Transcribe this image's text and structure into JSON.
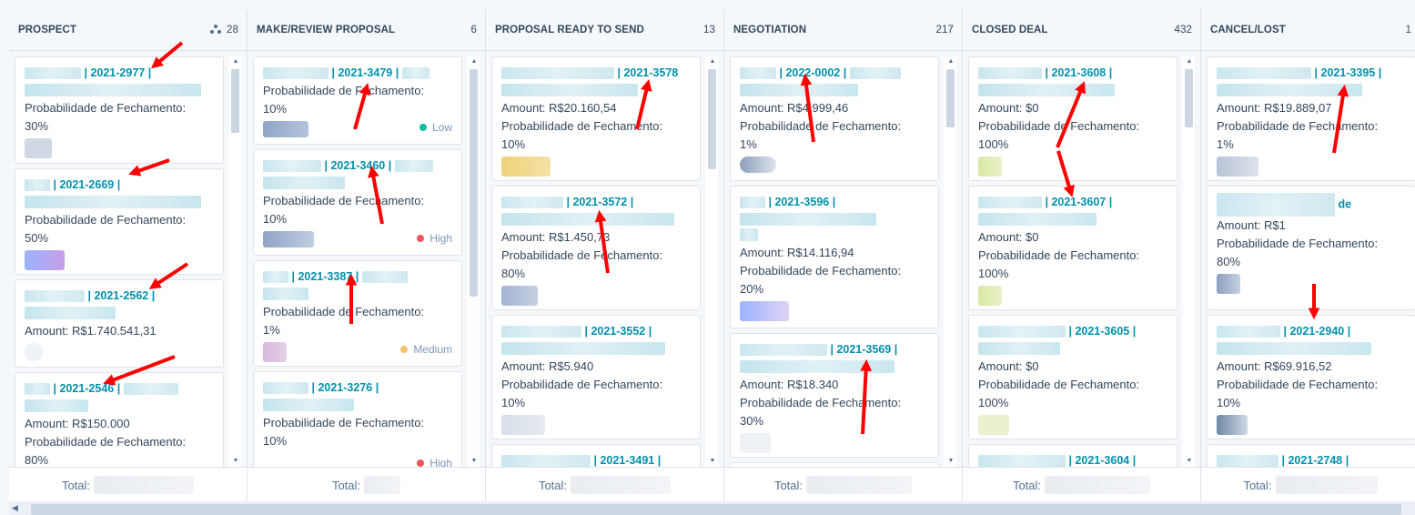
{
  "colors": {
    "accent": "#0091ae",
    "low": "#00bda5",
    "high": "#f2545b",
    "medium": "#f5c26b",
    "arrow": "#ff0000"
  },
  "columns": [
    {
      "name": "PROSPECT",
      "count": "28",
      "icon": "assign-icon",
      "footer": "Total:",
      "cards": [
        {
          "id": "| 2021-2977 |",
          "lines": [
            "Probabilidade de Fechamento:",
            "30%"
          ]
        },
        {
          "id": "| 2021-2669 |",
          "lines": [
            "Probabilidade de Fechamento:",
            "50%"
          ]
        },
        {
          "id": "| 2021-2562 |",
          "lines": [
            "Amount: R$1.740.541,31"
          ]
        },
        {
          "id": "| 2021-2546 |",
          "lines": [
            "Amount: R$150.000",
            "Probabilidade de Fechamento:",
            "80%"
          ]
        }
      ]
    },
    {
      "name": "MAKE/REVIEW PROPOSAL",
      "count": "6",
      "footer": "Total:",
      "cards": [
        {
          "id": "| 2021-3479 |",
          "lines": [
            "Probabilidade de Fechamento:",
            "10%"
          ],
          "priority": "Low"
        },
        {
          "id": "| 2021-3460 |",
          "lines": [
            "Probabilidade de Fechamento:",
            "10%"
          ],
          "priority": "High"
        },
        {
          "id": "| 2021-3387 |",
          "lines": [
            "Probabilidade de Fechamento:",
            "1%"
          ],
          "priority": "Medium"
        },
        {
          "id": "| 2021-3276 |",
          "lines": [
            "Probabilidade de Fechamento:",
            "10%"
          ],
          "priority": "High"
        }
      ]
    },
    {
      "name": "PROPOSAL READY TO SEND",
      "count": "13",
      "footer": "Total:",
      "cards": [
        {
          "id": "| 2021-3578",
          "lines": [
            "Amount: R$20.160,54",
            "Probabilidade de Fechamento:",
            "10%"
          ]
        },
        {
          "id": "| 2021-3572 |",
          "lines": [
            "Amount: R$1.450,73",
            "Probabilidade de Fechamento:",
            "80%"
          ]
        },
        {
          "id": "| 2021-3552 |",
          "lines": [
            "Amount: R$5.940",
            "Probabilidade de Fechamento:",
            "10%"
          ]
        },
        {
          "id": "| 2021-3491 |",
          "lines": []
        }
      ]
    },
    {
      "name": "NEGOTIATION",
      "count": "217",
      "footer": "Total:",
      "cards": [
        {
          "id": "| 2022-0002 |",
          "lines": [
            "Amount: R$4.999,46",
            "Probabilidade de Fechamento:",
            "1%"
          ]
        },
        {
          "id": "| 2021-3596 |",
          "lines": [
            "Amount: R$14.116,94",
            "Probabilidade de Fechamento:",
            "20%"
          ]
        },
        {
          "id": "| 2021-3569 |",
          "lines": [
            "Amount: R$18.340",
            "Probabilidade de Fechamento:",
            "30%"
          ]
        }
      ]
    },
    {
      "name": "CLOSED DEAL",
      "count": "432",
      "footer": "Total:",
      "cards": [
        {
          "id": "| 2021-3608 |",
          "lines": [
            "Amount: $0",
            "Probabilidade de Fechamento:",
            "100%"
          ]
        },
        {
          "id": "| 2021-3607 |",
          "lines": [
            "Amount: $0",
            "Probabilidade de Fechamento:",
            "100%"
          ]
        },
        {
          "id": "| 2021-3605 |",
          "lines": [
            "Amount: $0",
            "Probabilidade de Fechamento:",
            "100%"
          ]
        },
        {
          "id": "| 2021-3604 |",
          "lines": []
        }
      ]
    },
    {
      "name": "CANCEL/LOST",
      "count": "1",
      "footer": "Total:",
      "cards": [
        {
          "id": "| 2021-3395 |",
          "lines": [
            "Amount: R$19.889,07",
            "Probabilidade de Fechamento:",
            "1%"
          ]
        },
        {
          "id": "de",
          "lines": [
            "Amount: R$1",
            "Probabilidade de Fechamento:",
            "80%"
          ]
        },
        {
          "id": "| 2021-2940 |",
          "lines": [
            "Amount: R$69.916,52",
            "Probabilidade de Fechamento:",
            "10%"
          ]
        },
        {
          "id": "| 2021-2748 |",
          "lines": []
        }
      ]
    }
  ]
}
